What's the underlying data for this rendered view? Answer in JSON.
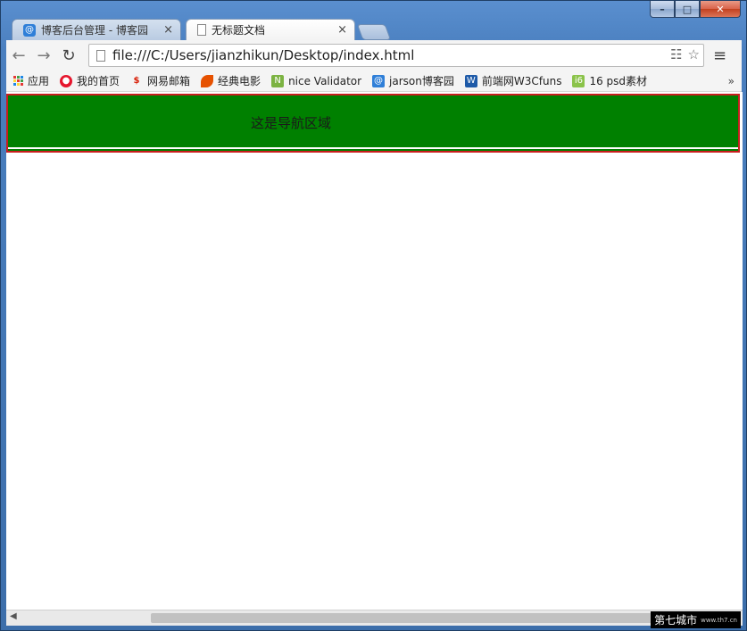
{
  "window": {
    "controls": {
      "minimize": "–",
      "maximize": "□",
      "close": "✕"
    }
  },
  "tabs": [
    {
      "title": "博客后台管理 - 博客园",
      "icon": "cnblogs-icon",
      "close": "×"
    },
    {
      "title": "无标题文档",
      "icon": "document-icon",
      "close": "×"
    }
  ],
  "toolbar": {
    "back": "←",
    "forward": "→",
    "reload": "↻",
    "url": "file:///C:/Users/jianzhikun/Desktop/index.html",
    "menu": "≡"
  },
  "bookmarks": {
    "items": [
      {
        "label": "应用",
        "icon": "apps-grid-icon",
        "color": "#e53935"
      },
      {
        "label": "我的首页",
        "icon": "weibo-icon",
        "color": "#e6162d"
      },
      {
        "label": "网易邮箱",
        "icon": "netease-mail-icon",
        "color": "#d81e06"
      },
      {
        "label": "经典电影",
        "icon": "leaf-icon",
        "color": "#e65100"
      },
      {
        "label": "nice Validator",
        "icon": "n-logo-icon",
        "color": "#7cb342"
      },
      {
        "label": "jarson博客园",
        "icon": "cnblogs-icon",
        "color": "#2f7fd8"
      },
      {
        "label": "前端网W3Cfuns",
        "icon": "w-logo-icon",
        "color": "#1e5aa8"
      },
      {
        "label": "16 psd素材",
        "icon": "i6-logo-icon",
        "color": "#8bc34a"
      }
    ],
    "more": "»"
  },
  "page": {
    "nav_text": "这是导航区域",
    "nav_bg": "#008000",
    "nav_border": "#c81e1e"
  },
  "watermark": {
    "text": "第七城市",
    "small": "www.th7.cn"
  }
}
